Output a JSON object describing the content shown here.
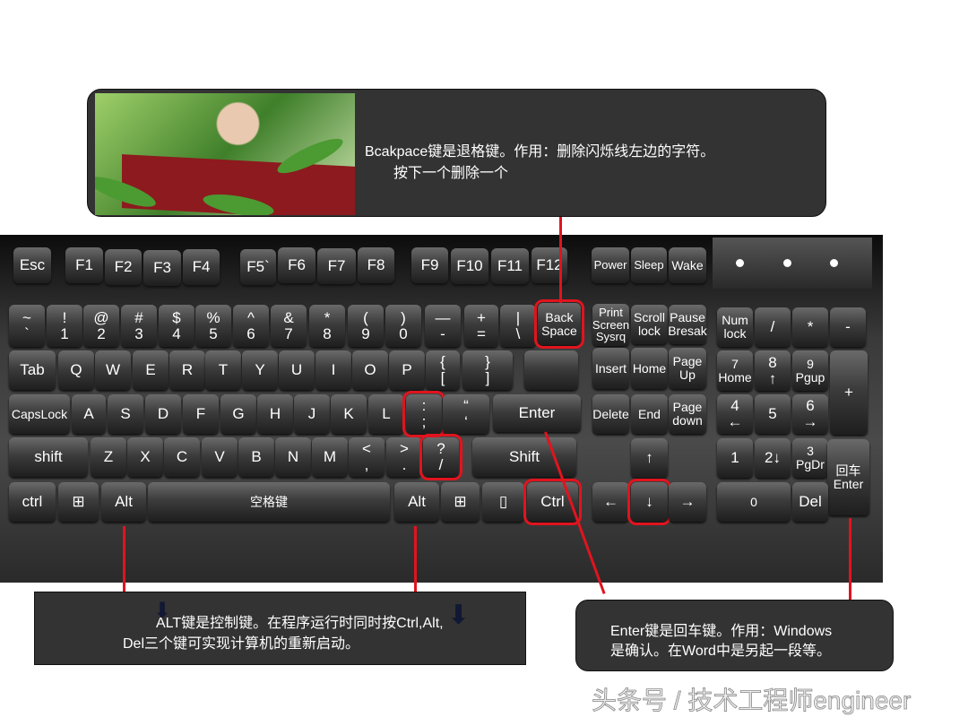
{
  "keyboard": {
    "keys": [
      "Esc",
      "F1",
      "F2",
      "F3",
      "F4",
      "F5`",
      "F6",
      "F7",
      "F8",
      "F9",
      "F10",
      "F11",
      "F12",
      "Power",
      "Sleep",
      "Wake",
      "~\n`",
      "!\n1",
      "@\n2",
      "#\n3",
      "$\n4",
      "%\n5",
      "^\n6",
      "&\n7",
      "*\n8",
      "(\n9",
      ")\n0",
      "—\n-",
      "+\n=",
      "|\n\\",
      "Back\nSpace",
      "Print\nScreen\nSysrq",
      "Scroll\nlock",
      "Pause\nBresak",
      "Num\nlock",
      "/",
      "*",
      "-",
      "Tab",
      "Q",
      "W",
      "E",
      "R",
      "T",
      "Y",
      "U",
      "I",
      "O",
      "P",
      "{\n[",
      "}\n]",
      "",
      "Insert",
      "Home",
      "Page\nUp",
      "7\nHome",
      "8\n↑",
      "9\nPgup",
      "+",
      "CapsLock",
      "A",
      "S",
      "D",
      "F",
      "G",
      "H",
      "J",
      "K",
      "L",
      ":\n;",
      "“\n‘",
      "Enter",
      "Delete",
      "End",
      "Page\ndown",
      "4\n←",
      "5",
      "6\n→",
      "shift",
      "Z",
      "X",
      "C",
      "V",
      "B",
      "N",
      "M",
      "<\n,",
      ">\n.",
      "?\n/",
      "Shift",
      "↑",
      "1",
      "2↓",
      "3\nPgDr",
      "回车\nEnter",
      "ctrl",
      "⊞",
      "Alt",
      "空格键",
      "Alt",
      "⊞",
      "▯",
      "Ctrl",
      "←",
      "↓",
      "→",
      "0",
      "Del"
    ],
    "highlighted_keys": [
      "Back\nSpace",
      "Enter",
      "Alt",
      "回车\nEnter"
    ],
    "indicator_lights": 3,
    "highlight_color": "#e0141e"
  },
  "callouts": {
    "backspace": {
      "line1": "Bcakpace键是退格键。作用：删除闪烁线左边的字符。",
      "line2": "按下一个删除一个"
    },
    "alt": {
      "line1": "ALT键是控制键。在程序运行时同时按Ctrl,Alt,",
      "line2": "Del三个键可实现计算机的重新启动。"
    },
    "enter": {
      "line1": "Enter键是回车键。作用：Windows",
      "line2": "是确认。在Word中是另起一段等。"
    }
  },
  "watermark": "头条号 / 技术工程师engineer"
}
